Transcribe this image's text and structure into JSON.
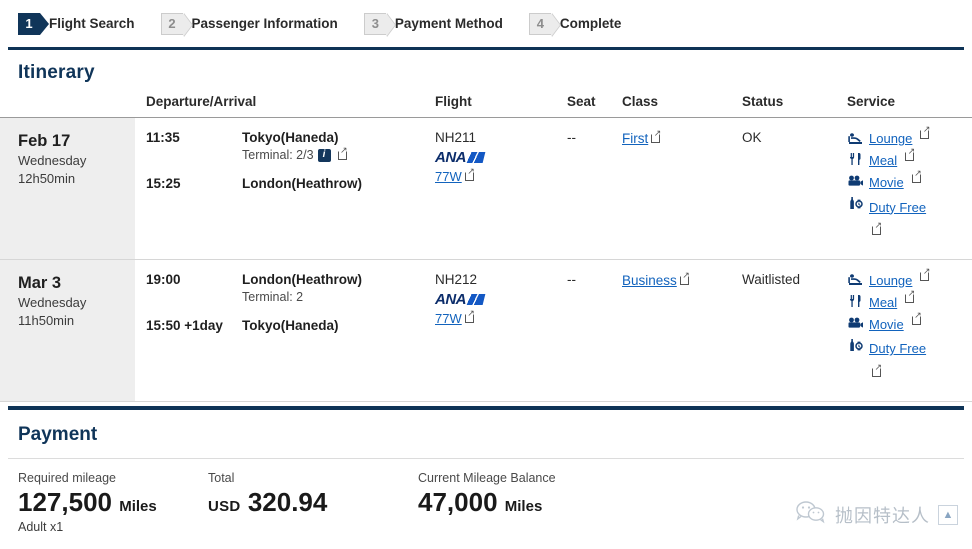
{
  "steps": [
    {
      "num": "1",
      "label": "Flight Search",
      "active": true
    },
    {
      "num": "2",
      "label": "Passenger Information",
      "active": false
    },
    {
      "num": "3",
      "label": "Payment Method",
      "active": false
    },
    {
      "num": "4",
      "label": "Complete",
      "active": false
    }
  ],
  "itinerary": {
    "title": "Itinerary",
    "columns": {
      "date": "",
      "departure_arrival": "Departure/Arrival",
      "flight": "Flight",
      "seat": "Seat",
      "class": "Class",
      "status": "Status",
      "service": "Service"
    },
    "rows": [
      {
        "date": "Feb 17",
        "day_of_week": "Wednesday",
        "duration": "12h50min",
        "depart_time": "11:35",
        "depart_place": "Tokyo(Haneda)",
        "terminal": "Terminal: 2/3",
        "terminal_info_icon": "info-icon",
        "arrive_time": "15:25",
        "arrive_place": "London(Heathrow)",
        "flight_no": "NH211",
        "airline": "ANA",
        "aircraft": "77W",
        "seat": "--",
        "class": "First",
        "status": "OK",
        "services": [
          {
            "label": "Lounge",
            "icon": "lounge-chair-icon"
          },
          {
            "label": "Meal",
            "icon": "fork-knife-icon"
          },
          {
            "label": "Movie",
            "icon": "movie-camera-icon"
          },
          {
            "label": "Duty Free",
            "icon": "bottle-watch-icon"
          }
        ]
      },
      {
        "date": "Mar 3",
        "day_of_week": "Wednesday",
        "duration": "11h50min",
        "depart_time": "19:00",
        "depart_place": "London(Heathrow)",
        "terminal": "Terminal: 2",
        "terminal_info_icon": "",
        "arrive_time": "15:50 +1day",
        "arrive_place": "Tokyo(Haneda)",
        "flight_no": "NH212",
        "airline": "ANA",
        "aircraft": "77W",
        "seat": "--",
        "class": "Business",
        "status": "Waitlisted",
        "services": [
          {
            "label": "Lounge",
            "icon": "lounge-chair-icon"
          },
          {
            "label": "Meal",
            "icon": "fork-knife-icon"
          },
          {
            "label": "Movie",
            "icon": "movie-camera-icon"
          },
          {
            "label": "Duty Free",
            "icon": "bottle-watch-icon"
          }
        ]
      }
    ]
  },
  "payment": {
    "title": "Payment",
    "required_mileage": {
      "label": "Required mileage",
      "value": "127,500",
      "unit": "Miles",
      "sub": "Adult x1"
    },
    "total": {
      "label": "Total",
      "currency": "USD",
      "value": "320.94"
    },
    "balance": {
      "label": "Current Mileage Balance",
      "value": "47,000",
      "unit": "Miles"
    }
  },
  "watermark": {
    "icon": "wechat-icon",
    "text": "抛因特达人",
    "badge": "▲"
  },
  "colors": {
    "navy": "#103559",
    "link": "#1263bd",
    "ana_blue": "#0c2d6b",
    "row_alt": "#eeeeee"
  }
}
